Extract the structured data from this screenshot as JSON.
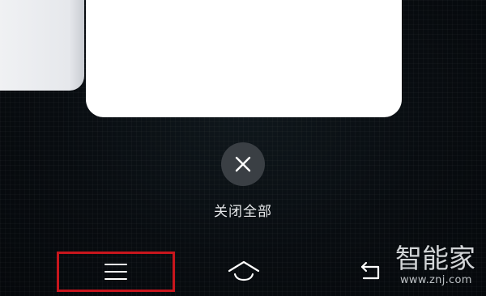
{
  "recents": {
    "close_all_label": "关闭全部"
  },
  "icons": {
    "close": "close-icon",
    "menu": "menu-icon",
    "home": "home-icon",
    "back": "back-icon"
  },
  "colors": {
    "highlight_box": "#c8161d",
    "close_button_bg": "#3a3f44"
  },
  "watermark": {
    "brand": "智能家",
    "url": "www.znj.com"
  }
}
